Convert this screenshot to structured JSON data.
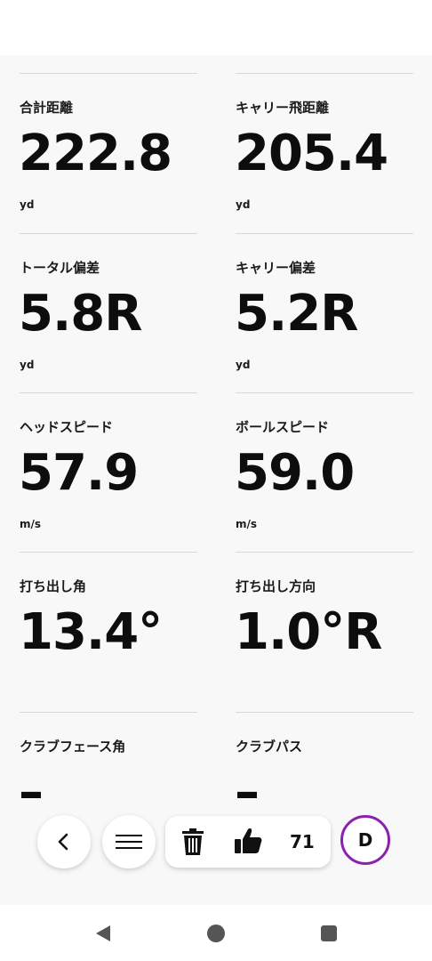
{
  "metrics": [
    {
      "label": "合計距離",
      "value": "222.8",
      "unit": "yd"
    },
    {
      "label": "キャリー飛距離",
      "value": "205.4",
      "unit": "yd"
    },
    {
      "label": "トータル偏差",
      "value": "5.8R",
      "unit": "yd"
    },
    {
      "label": "キャリー偏差",
      "value": "5.2R",
      "unit": "yd"
    },
    {
      "label": "ヘッドスピード",
      "value": "57.9",
      "unit": "m/s"
    },
    {
      "label": "ボールスピード",
      "value": "59.0",
      "unit": "m/s"
    },
    {
      "label": "打ち出し角",
      "value": "13.4°",
      "unit": ""
    },
    {
      "label": "打ち出し方向",
      "value": "1.0°R",
      "unit": ""
    },
    {
      "label": "クラブフェース角",
      "value": "–",
      "unit": ""
    },
    {
      "label": "クラブパス",
      "value": "–",
      "unit": ""
    }
  ],
  "toolbar": {
    "back_icon": "chevron-left-icon",
    "menu_icon": "hamburger-menu-icon",
    "delete_icon": "trash-icon",
    "like_icon": "thumbs-up-icon",
    "like_count": "71",
    "club_label": "D",
    "club_ring_color": "#8a22b0"
  },
  "system_nav": {
    "back_icon": "triangle-back-icon",
    "home_icon": "circle-home-icon",
    "recents_icon": "square-recents-icon"
  }
}
